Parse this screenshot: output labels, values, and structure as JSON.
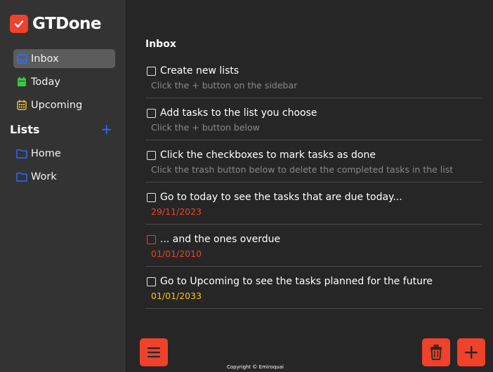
{
  "app": {
    "name": "GTDone",
    "copyright": "Copyright © Emiroquai"
  },
  "sidebar": {
    "nav": [
      {
        "label": "Inbox",
        "icon": "inbox-icon",
        "color": "#2f6bff"
      },
      {
        "label": "Today",
        "icon": "calendar-icon",
        "color": "#2ecc40"
      },
      {
        "label": "Upcoming",
        "icon": "calendar-grid-icon",
        "color": "#f5c518"
      }
    ],
    "lists_title": "Lists",
    "lists_add": "+",
    "lists": [
      {
        "label": "Home",
        "icon": "folder-icon"
      },
      {
        "label": "Work",
        "icon": "folder-icon"
      }
    ]
  },
  "main": {
    "title": "Inbox",
    "tasks": [
      {
        "title": "Create new lists",
        "sub": "Click the + button on the sidebar",
        "sub_color": "gray",
        "checked": false
      },
      {
        "title": "Add tasks to the list you choose",
        "sub": "Click the + button below",
        "sub_color": "gray",
        "checked": false
      },
      {
        "title": "Click the checkboxes to mark tasks as done",
        "sub": "Click the trash button below to delete the completed tasks in the list",
        "sub_color": "gray",
        "checked": false
      },
      {
        "title": "Go to today to see the tasks that are due today...",
        "sub": "29/11/2023",
        "sub_color": "red",
        "checked": false
      },
      {
        "title": "... and the ones overdue",
        "sub": "01/01/2010",
        "sub_color": "red",
        "checked": false
      },
      {
        "title": "Go to Upcoming to see the tasks planned for the future",
        "sub": "01/01/2033",
        "sub_color": "yellow",
        "checked": false
      }
    ]
  },
  "colors": {
    "accent": "#f0412a",
    "sidebar_bg": "#333333",
    "main_bg": "#262626",
    "active_item_bg": "#5c5c5c",
    "link_blue": "#2f6bff"
  }
}
